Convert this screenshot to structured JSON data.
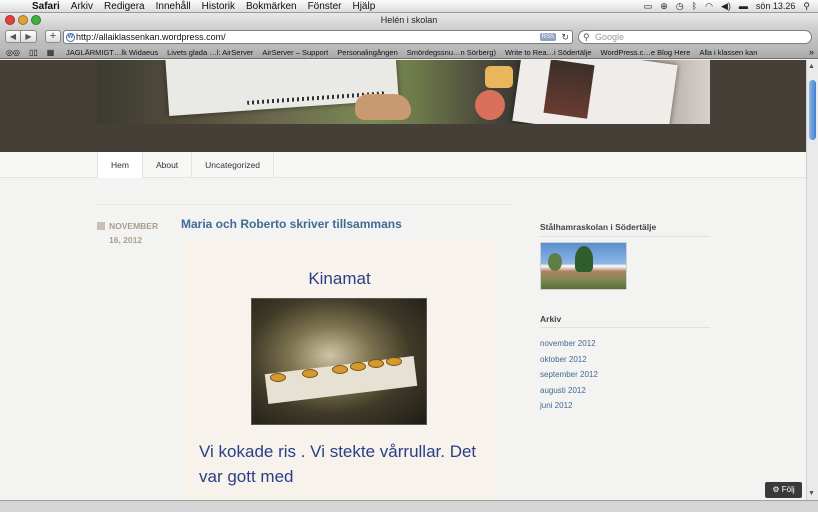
{
  "os_menubar": {
    "apple": "",
    "menus": [
      "Safari",
      "Arkiv",
      "Redigera",
      "Innehåll",
      "Historik",
      "Bokmärken",
      "Fönster",
      "Hjälp"
    ],
    "clock": "sön 13.26"
  },
  "window": {
    "title": "Helén i skolan",
    "url": "http://allaiklassenkan.wordpress.com/",
    "rss": "RSS",
    "search_placeholder": "Google"
  },
  "bookmarks": [
    "JAGLÄRMIGT…lk Widaeus",
    "Livets glada …l: AirServer",
    "AirServer – Support",
    "Personalingången",
    "Smördegssnu…n Sörberg)",
    "Write to Rea…i Södertälje",
    "WordPress.c…e Blog Here",
    "Alla i klassen kan"
  ],
  "nav": {
    "tabs": [
      "Hem",
      "About",
      "Uncategorized"
    ]
  },
  "post": {
    "date_line1": "NOVEMBER",
    "date_line2": "16, 2012",
    "title": "Maria och Roberto skriver tillsammans",
    "image_title": "Kinamat",
    "image_text": "Vi kokade ris . Vi stekte vårrullar. Det var gott med"
  },
  "sidebar": {
    "widget1_title": "Stålhamraskolan i Södertälje",
    "arkiv_title": "Arkiv",
    "arkiv_items": [
      "november 2012",
      "oktober 2012",
      "september 2012",
      "augusti 2012",
      "juni 2012"
    ]
  },
  "follow": {
    "label": "Följ"
  }
}
